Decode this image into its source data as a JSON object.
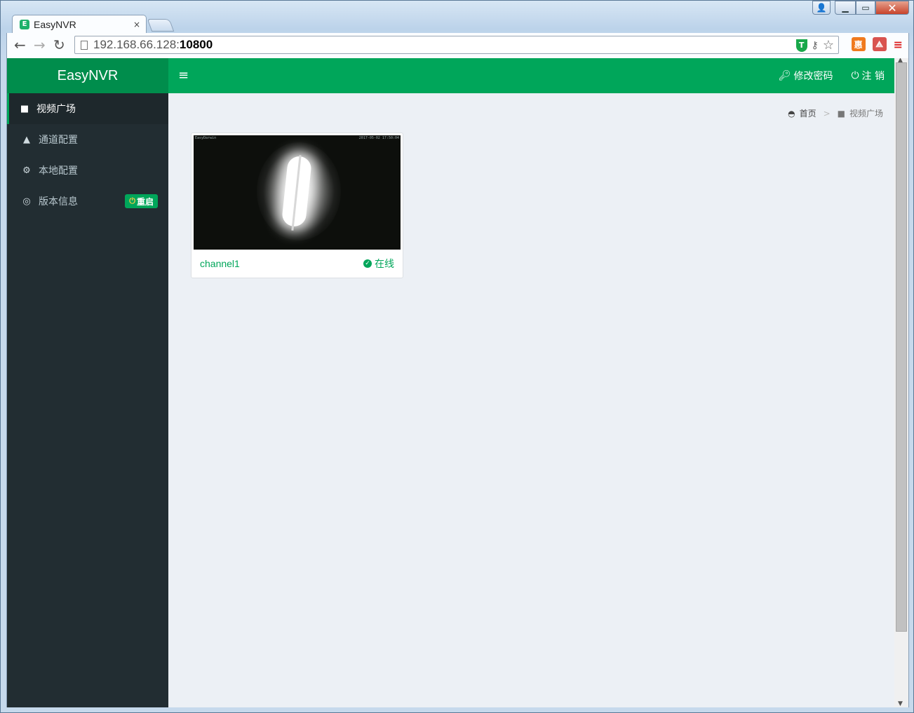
{
  "browser": {
    "tab_title": "EasyNVR",
    "tab_close": "×",
    "url_host": "192.168.66.128:",
    "url_port": "10800"
  },
  "header": {
    "brand": "EasyNVR",
    "menu_icon": "≡",
    "change_password": "修改密码",
    "logout": "注 销"
  },
  "sidebar": {
    "items": [
      {
        "label": "视频广场",
        "icon": "video-camera-icon",
        "active": true
      },
      {
        "label": "通道配置",
        "icon": "road-icon"
      },
      {
        "label": "本地配置",
        "icon": "cogs-icon"
      },
      {
        "label": "版本信息",
        "icon": "life-ring-icon"
      }
    ],
    "restart_label": "重启"
  },
  "breadcrumb": {
    "home": "首页",
    "separator": ">",
    "current": "视频广场"
  },
  "channels": [
    {
      "name": "channel1",
      "status": "在线",
      "osd_left": "EasyDarwin",
      "osd_right": "2017-05-02 17:50:04"
    }
  ],
  "colors": {
    "accent": "#00a65a",
    "accent_dark": "#008d4c",
    "sidebar_bg": "#222d32",
    "content_bg": "#ecf0f5"
  }
}
